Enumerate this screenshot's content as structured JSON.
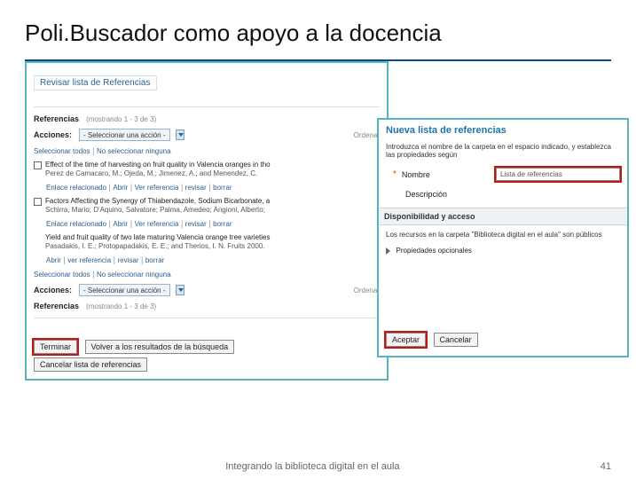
{
  "slide": {
    "title": "Poli.Buscador como apoyo a la docencia",
    "footer_text": "Integrando la biblioteca digital en el aula",
    "page_number": "41"
  },
  "left_panel": {
    "revisar": "Revisar lista de Referencias",
    "refs_label": "Referencias",
    "refs_count": "(mostrando 1 - 3 de 3)",
    "acciones_label": "Acciones:",
    "acciones_select": "- Seleccionar una acción -",
    "ordenar": "Ordenar",
    "sel_all": "Seleccionar todos",
    "sel_none": "No seleccionar ninguna",
    "items": [
      {
        "title": "Effect of the time of harvesting on fruit quality in Valencia oranges in tho",
        "authors": "Perez de Camacaro, M.; Ojeda, M.; Jimenez, A.; and Menendez, C.",
        "links": [
          "Enlace relacionado",
          "Abrir",
          "Ver referencia",
          "revisar",
          "borrar"
        ]
      },
      {
        "title": "Factors Affecting the Synergy of Thiabendazole, Sodium Bicarbonate, a",
        "authors": "Schirra, Mario; D'Aquino, Salvatore; Palma, Amedeo; Angioni, Alberto;",
        "links": [
          "Enlace relacionado",
          "Abrir",
          "Ver referencia",
          "revisar",
          "borrar"
        ]
      },
      {
        "title": "Yield and fruit quality of two late maturing Valencia orange tree varieties",
        "authors": "Pasadakis, I. E.; Protopapadakis, E. E.; and Therios, I. N. Fruits 2000.",
        "links": [
          "Abrir",
          "ver referencia",
          "revisar",
          "borrar"
        ]
      }
    ],
    "btn_terminar": "Terminar",
    "btn_volver": "Volver a los resultados de la búsqueda",
    "btn_cancelar": "Cancelar lista de referencias"
  },
  "right_panel": {
    "title": "Nueva lista de referencias",
    "intro": "Introduzca el nombre de la carpeta en el espacio indicado, y establezca las propiedades según",
    "nombre_label": "Nombre",
    "nombre_value": "Lista de referencias",
    "desc_label": "Descripción",
    "avail_header": "Disponibilidad y acceso",
    "avail_text": "Los recursos en la carpeta \"Biblioteca digital en el aula\" son públicos",
    "props": "Propiedades opcionales",
    "btn_aceptar": "Aceptar",
    "btn_cancelar": "Cancelar"
  }
}
